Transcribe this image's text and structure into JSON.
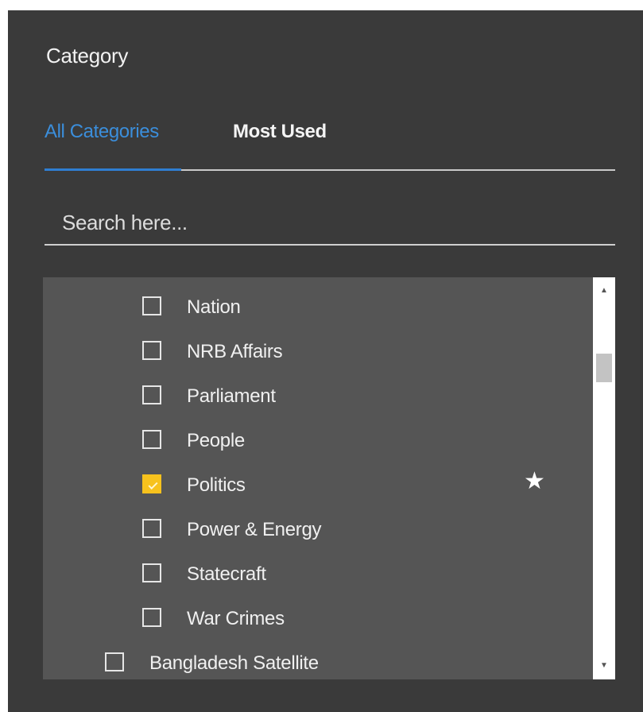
{
  "panel": {
    "title": "Category"
  },
  "tabs": [
    {
      "label": "All Categories",
      "active": true
    },
    {
      "label": "Most Used",
      "active": false
    }
  ],
  "search": {
    "placeholder": "Search here...",
    "value": ""
  },
  "categories": [
    {
      "label": "Nation",
      "checked": false,
      "level": 2
    },
    {
      "label": "NRB Affairs",
      "checked": false,
      "level": 2
    },
    {
      "label": "Parliament",
      "checked": false,
      "level": 2
    },
    {
      "label": "People",
      "checked": false,
      "level": 2
    },
    {
      "label": "Politics",
      "checked": true,
      "level": 2,
      "starred": true,
      "star_icon": "star-icon"
    },
    {
      "label": "Power & Energy",
      "checked": false,
      "level": 2
    },
    {
      "label": "Statecraft",
      "checked": false,
      "level": 2
    },
    {
      "label": "War Crimes",
      "checked": false,
      "level": 2
    },
    {
      "label": "Bangladesh Satellite",
      "checked": false,
      "level": 1
    }
  ],
  "scrollbar": {
    "up_icon": "arrow-up-icon",
    "down_icon": "arrow-down-icon"
  },
  "colors": {
    "panel_bg": "#3a3a3a",
    "list_bg": "#555555",
    "accent": "#2f7ed1",
    "checked": "#f7c21d"
  }
}
